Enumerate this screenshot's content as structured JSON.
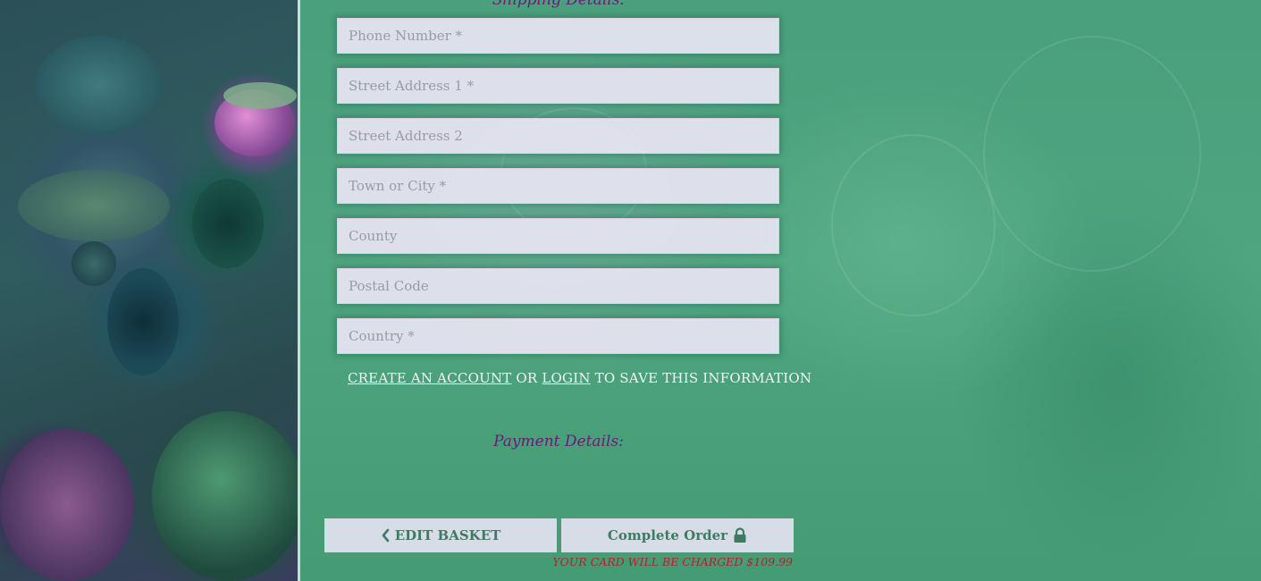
{
  "shipping": {
    "title": "Shipping Details:",
    "fields": {
      "phone": {
        "placeholder": "Phone Number *",
        "value": ""
      },
      "street1": {
        "placeholder": "Street Address 1 *",
        "value": ""
      },
      "street2": {
        "placeholder": "Street Address 2",
        "value": ""
      },
      "town": {
        "placeholder": "Town or City *",
        "value": ""
      },
      "county": {
        "placeholder": "County",
        "value": ""
      },
      "postal": {
        "placeholder": "Postal Code",
        "value": ""
      },
      "country": {
        "placeholder": "Country *",
        "value": ""
      }
    },
    "save_info": {
      "create_account": "CREATE AN ACCOUNT",
      "or": "OR",
      "login": "LOGIN",
      "rest": "TO SAVE THIS INFORMATION"
    }
  },
  "payment": {
    "title": "Payment Details:"
  },
  "actions": {
    "edit_basket_label": "EDIT BASKET",
    "edit_basket_icon": "chevron-left-icon",
    "complete_order_label": "Complete Order",
    "complete_order_icon": "lock-icon",
    "charge_note": "YOUR CARD WILL BE CHARGED $109.99"
  },
  "colors": {
    "background": "#49a27a",
    "title_purple": "#6b1a7c",
    "button_text": "#3f7a63",
    "warning_red": "#b81f2e"
  }
}
